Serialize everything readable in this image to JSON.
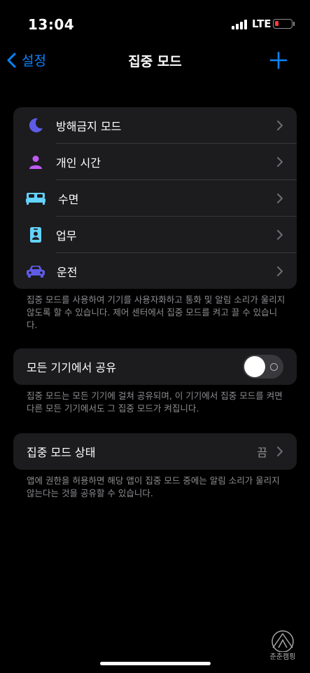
{
  "status_bar": {
    "time": "13:04",
    "network": "LTE"
  },
  "nav": {
    "back_label": "설정",
    "title": "집중 모드"
  },
  "focus_modes": [
    {
      "label": "방해금지 모드",
      "icon": "moon-icon",
      "color": "#5e5ce6"
    },
    {
      "label": "개인 시간",
      "icon": "person-icon",
      "color": "#bf5af2"
    },
    {
      "label": "수면",
      "icon": "bed-icon",
      "color": "#64d2ff"
    },
    {
      "label": "업무",
      "icon": "id-badge-icon",
      "color": "#64d2ff"
    },
    {
      "label": "운전",
      "icon": "car-icon",
      "color": "#5e5ce6"
    }
  ],
  "focus_footnote": "집중 모드를 사용하여 기기를 사용자화하고 통화 및 알림 소리가 울리지 않도록 할 수 있습니다. 제어 센터에서 집중 모드를 켜고 끌 수 있습니다.",
  "share": {
    "label": "모든 기기에서 공유",
    "enabled": false,
    "footnote": "집중 모드는 모든 기기에 걸쳐 공유되며, 이 기기에서 집중 모드를 켜면 다른 모든 기기에서도 그 집중 모드가 켜집니다."
  },
  "status": {
    "label": "집중 모드 상태",
    "value": "끔",
    "footnote": "앱에 권한을 허용하면 해당 앱이 집중 모드 중에는 알림 소리가 울리지 않는다는 것을 공유할 수 있습니다."
  },
  "watermark": {
    "text": "춘춘캠핑"
  },
  "colors": {
    "accent": "#0a84ff",
    "background": "#000000",
    "cell": "#1c1c1e",
    "secondary_text": "#8e8e93"
  }
}
